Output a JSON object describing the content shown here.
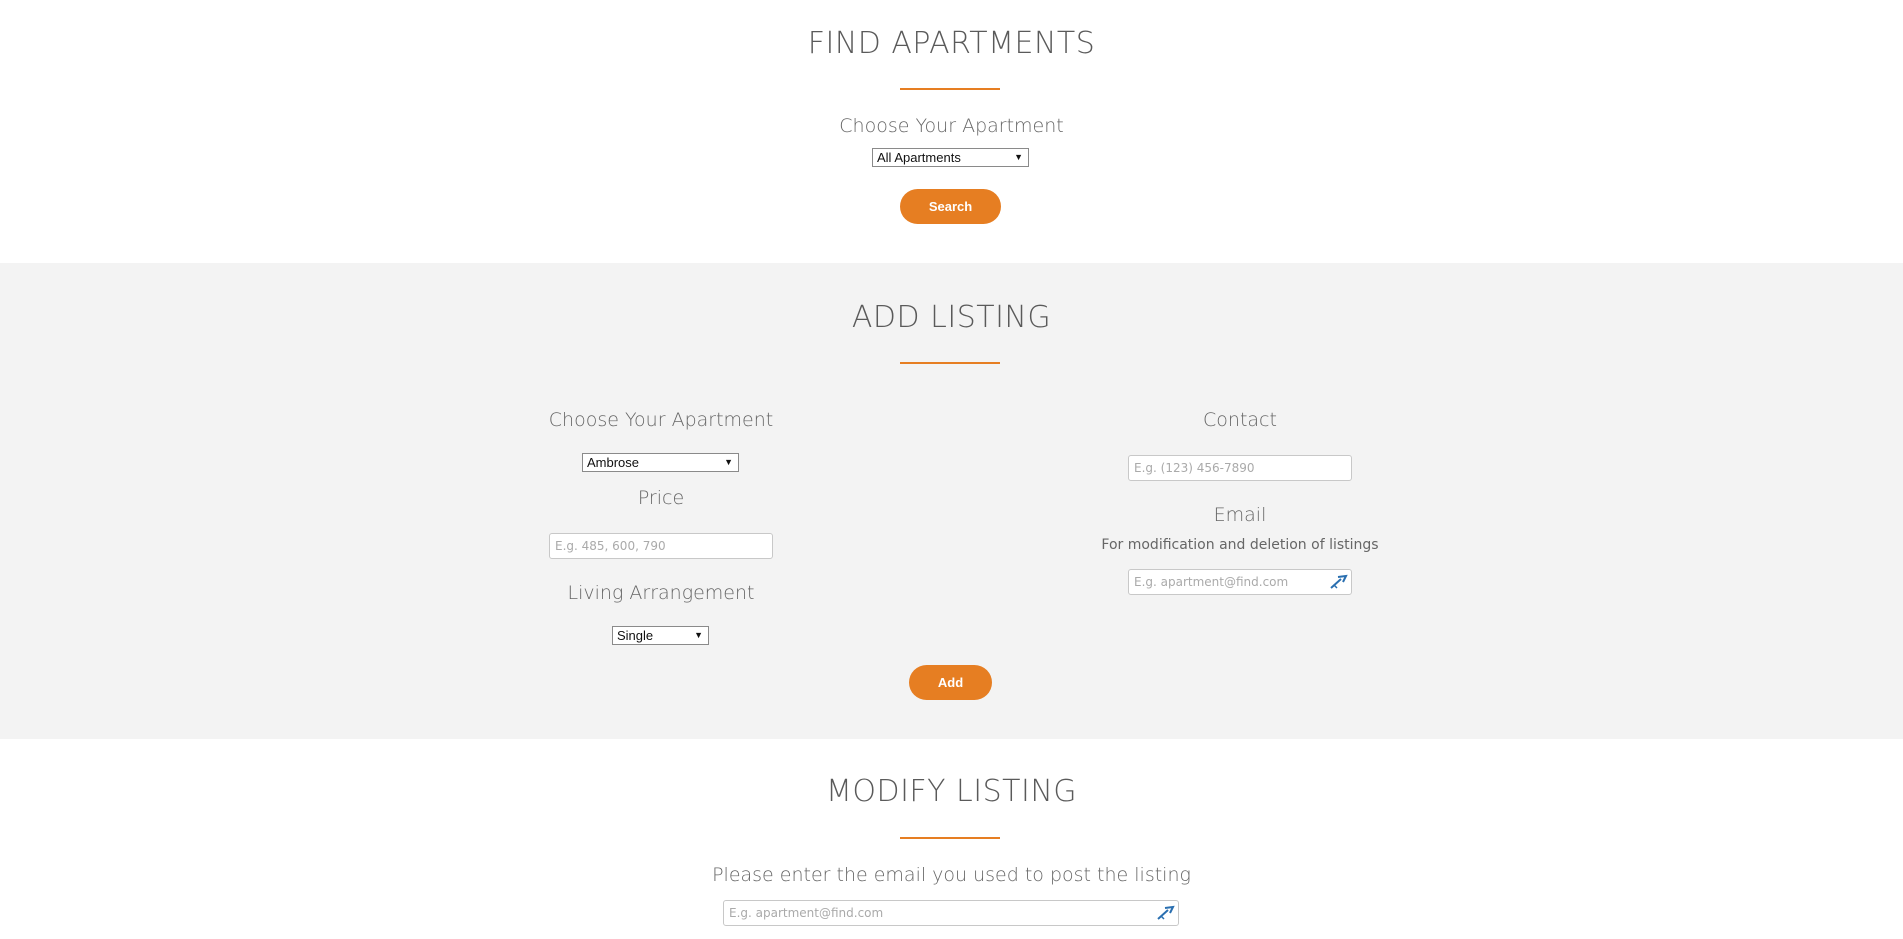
{
  "find": {
    "title": "FIND APARTMENTS",
    "choose_label": "Choose Your Apartment",
    "apartment_select": "All Apartments",
    "search_button": "Search"
  },
  "add": {
    "title": "ADD LISTING",
    "choose_label": "Choose Your Apartment",
    "apartment_select": "Ambrose",
    "price_label": "Price",
    "price_placeholder": "E.g. 485, 600, 790",
    "living_label": "Living Arrangement",
    "living_select": "Single",
    "contact_label": "Contact",
    "contact_placeholder": "E.g. (123) 456-7890",
    "email_label": "Email",
    "email_note": "For modification and deletion of listings",
    "email_placeholder": "E.g. apartment@find.com",
    "add_button": "Add"
  },
  "modify": {
    "title": "MODIFY LISTING",
    "prompt": "Please enter the email you used to post the listing",
    "email_placeholder": "E.g. apartment@find.com"
  },
  "colors": {
    "accent": "#e67e22",
    "alt_background": "#f3f3f3"
  },
  "icons": {
    "email_autofill": "autofill-key-icon"
  }
}
